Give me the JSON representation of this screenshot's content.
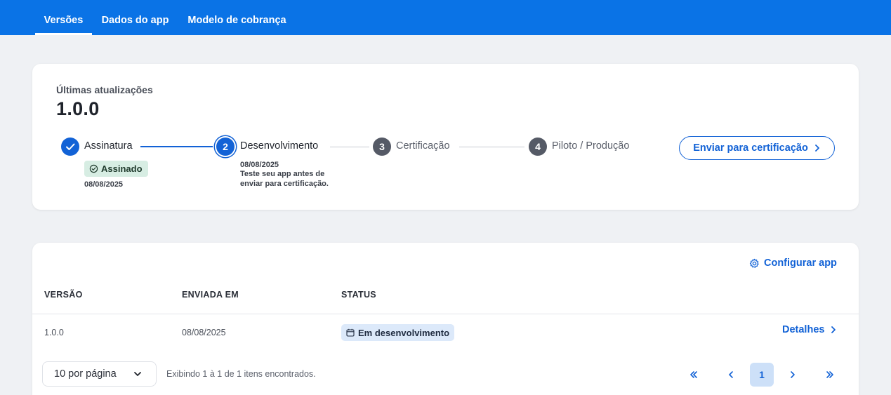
{
  "nav": {
    "tabs": [
      {
        "label": "Versões",
        "active": true
      },
      {
        "label": "Dados do app",
        "active": false
      },
      {
        "label": "Modelo de cobrança",
        "active": false
      }
    ]
  },
  "updates": {
    "heading": "Últimas atualizações",
    "version": "1.0.0",
    "steps": [
      {
        "number": "1",
        "label": "Assinatura",
        "state": "done",
        "badge": "Assinado",
        "date": "08/08/2025"
      },
      {
        "number": "2",
        "label": "Desenvolvimento",
        "state": "current",
        "date": "08/08/2025",
        "description": "Teste seu app antes de enviar para certificação."
      },
      {
        "number": "3",
        "label": "Certificação",
        "state": "pending"
      },
      {
        "number": "4",
        "label": "Piloto / Produção",
        "state": "pending"
      }
    ],
    "send_button": "Enviar para certificação"
  },
  "versions_table": {
    "config_link": "Configurar app",
    "columns": [
      "VERSÃO",
      "ENVIADA EM",
      "STATUS"
    ],
    "rows": [
      {
        "version": "1.0.0",
        "sent_at": "08/08/2025",
        "status": "Em desenvolvimento",
        "action": "Detalhes"
      }
    ],
    "per_page": "10 por página",
    "showing": "Exibindo 1 à 1 de 1 itens encontrados.",
    "current_page": "1"
  },
  "colors": {
    "primary": "#0a73e6",
    "accent": "#1262d6",
    "signed_badge_bg": "#d7ede3",
    "status_badge_bg": "#dce9fa"
  }
}
